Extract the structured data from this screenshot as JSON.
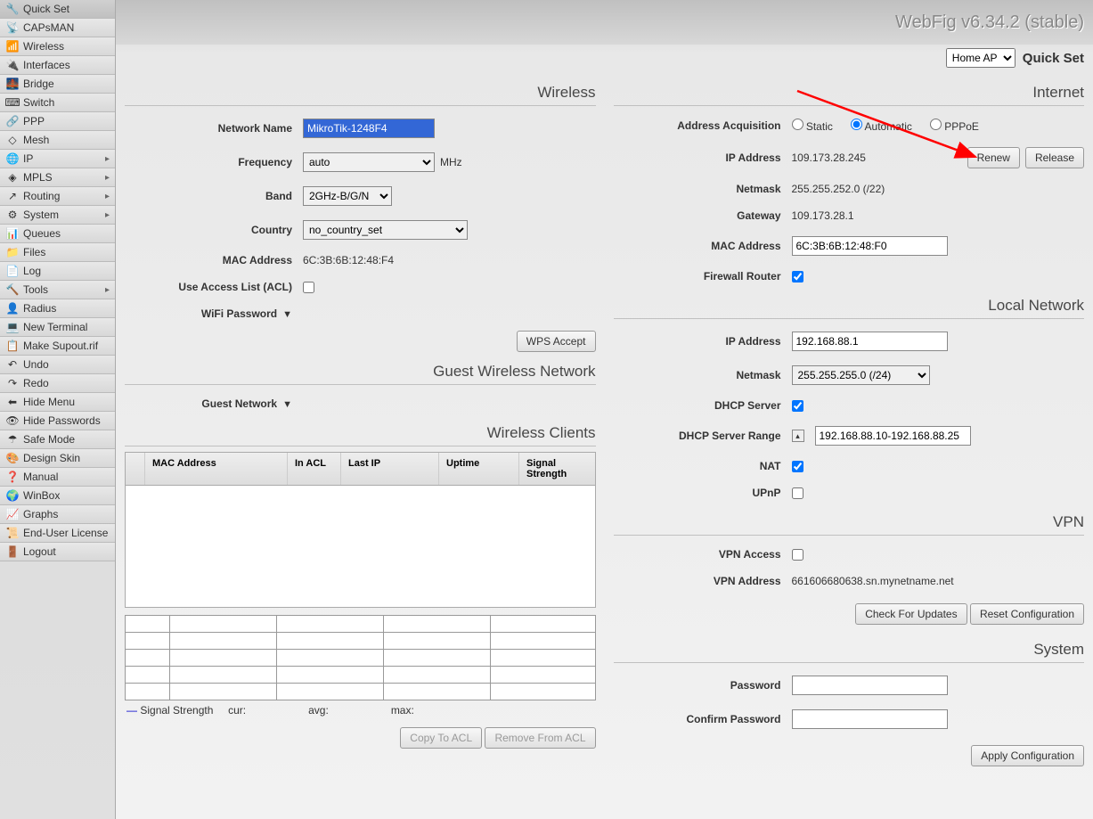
{
  "app": {
    "title": "WebFig v6.34.2 (stable)",
    "mode_select": "Home AP",
    "page_name": "Quick Set"
  },
  "sidebar": {
    "items": [
      {
        "label": "Quick Set",
        "icon": "🔧",
        "active": true
      },
      {
        "label": "CAPsMAN",
        "icon": "📡"
      },
      {
        "label": "Wireless",
        "icon": "📶"
      },
      {
        "label": "Interfaces",
        "icon": "🔌"
      },
      {
        "label": "Bridge",
        "icon": "🌉"
      },
      {
        "label": "Switch",
        "icon": "⌨"
      },
      {
        "label": "PPP",
        "icon": "🔗"
      },
      {
        "label": "Mesh",
        "icon": "◇"
      },
      {
        "label": "IP",
        "icon": "🌐",
        "sub": true
      },
      {
        "label": "MPLS",
        "icon": "◈",
        "sub": true
      },
      {
        "label": "Routing",
        "icon": "↗",
        "sub": true
      },
      {
        "label": "System",
        "icon": "⚙",
        "sub": true
      },
      {
        "label": "Queues",
        "icon": "📊"
      },
      {
        "label": "Files",
        "icon": "📁"
      },
      {
        "label": "Log",
        "icon": "📄"
      },
      {
        "label": "Tools",
        "icon": "🔨",
        "sub": true
      },
      {
        "label": "Radius",
        "icon": "👤"
      },
      {
        "label": "New Terminal",
        "icon": "💻"
      },
      {
        "label": "Make Supout.rif",
        "icon": "📋"
      },
      {
        "label": "Undo",
        "icon": "↶"
      },
      {
        "label": "Redo",
        "icon": "↷"
      },
      {
        "label": "Hide Menu",
        "icon": "⬅"
      },
      {
        "label": "Hide Passwords",
        "icon": "👁"
      },
      {
        "label": "Safe Mode",
        "icon": "☂"
      },
      {
        "label": "Design Skin",
        "icon": "🎨"
      },
      {
        "label": "Manual",
        "icon": "❓"
      },
      {
        "label": "WinBox",
        "icon": "🌍"
      },
      {
        "label": "Graphs",
        "icon": "📈"
      },
      {
        "label": "End-User License",
        "icon": "📜"
      },
      {
        "label": "Logout",
        "icon": "🚪"
      }
    ]
  },
  "wireless": {
    "title": "Wireless",
    "network_name_label": "Network Name",
    "network_name_value": "MikroTik-1248F4",
    "frequency_label": "Frequency",
    "frequency_value": "auto",
    "frequency_unit": "MHz",
    "band_label": "Band",
    "band_value": "2GHz-B/G/N",
    "country_label": "Country",
    "country_value": "no_country_set",
    "mac_label": "MAC Address",
    "mac_value": "6C:3B:6B:12:48:F4",
    "acl_label": "Use Access List (ACL)",
    "wifi_pw_label": "WiFi Password",
    "wps_btn": "WPS Accept"
  },
  "guest": {
    "title": "Guest Wireless Network",
    "guest_label": "Guest Network"
  },
  "clients": {
    "title": "Wireless Clients",
    "headers": [
      "MAC Address",
      "In ACL",
      "Last IP",
      "Uptime",
      "Signal Strength"
    ],
    "legend_label": "Signal Strength",
    "cur": "cur:",
    "avg": "avg:",
    "max": "max:",
    "copy_btn": "Copy To ACL",
    "remove_btn": "Remove From ACL"
  },
  "internet": {
    "title": "Internet",
    "acq_label": "Address Acquisition",
    "acq_static": "Static",
    "acq_auto": "Automatic",
    "acq_pppoe": "PPPoE",
    "ip_label": "IP Address",
    "ip_value": "109.173.28.245",
    "renew_btn": "Renew",
    "release_btn": "Release",
    "netmask_label": "Netmask",
    "netmask_value": "255.255.252.0 (/22)",
    "gateway_label": "Gateway",
    "gateway_value": "109.173.28.1",
    "mac_label": "MAC Address",
    "mac_value": "6C:3B:6B:12:48:F0",
    "fw_label": "Firewall Router"
  },
  "local": {
    "title": "Local Network",
    "ip_label": "IP Address",
    "ip_value": "192.168.88.1",
    "netmask_label": "Netmask",
    "netmask_value": "255.255.255.0 (/24)",
    "dhcp_label": "DHCP Server",
    "dhcp_range_label": "DHCP Server Range",
    "dhcp_range_value": "192.168.88.10-192.168.88.25",
    "nat_label": "NAT",
    "upnp_label": "UPnP"
  },
  "vpn": {
    "title": "VPN",
    "access_label": "VPN Access",
    "addr_label": "VPN Address",
    "addr_value": "661606680638.sn.mynetname.net",
    "check_btn": "Check For Updates",
    "reset_btn": "Reset Configuration"
  },
  "system": {
    "title": "System",
    "pw_label": "Password",
    "cpw_label": "Confirm Password",
    "apply_btn": "Apply Configuration"
  }
}
